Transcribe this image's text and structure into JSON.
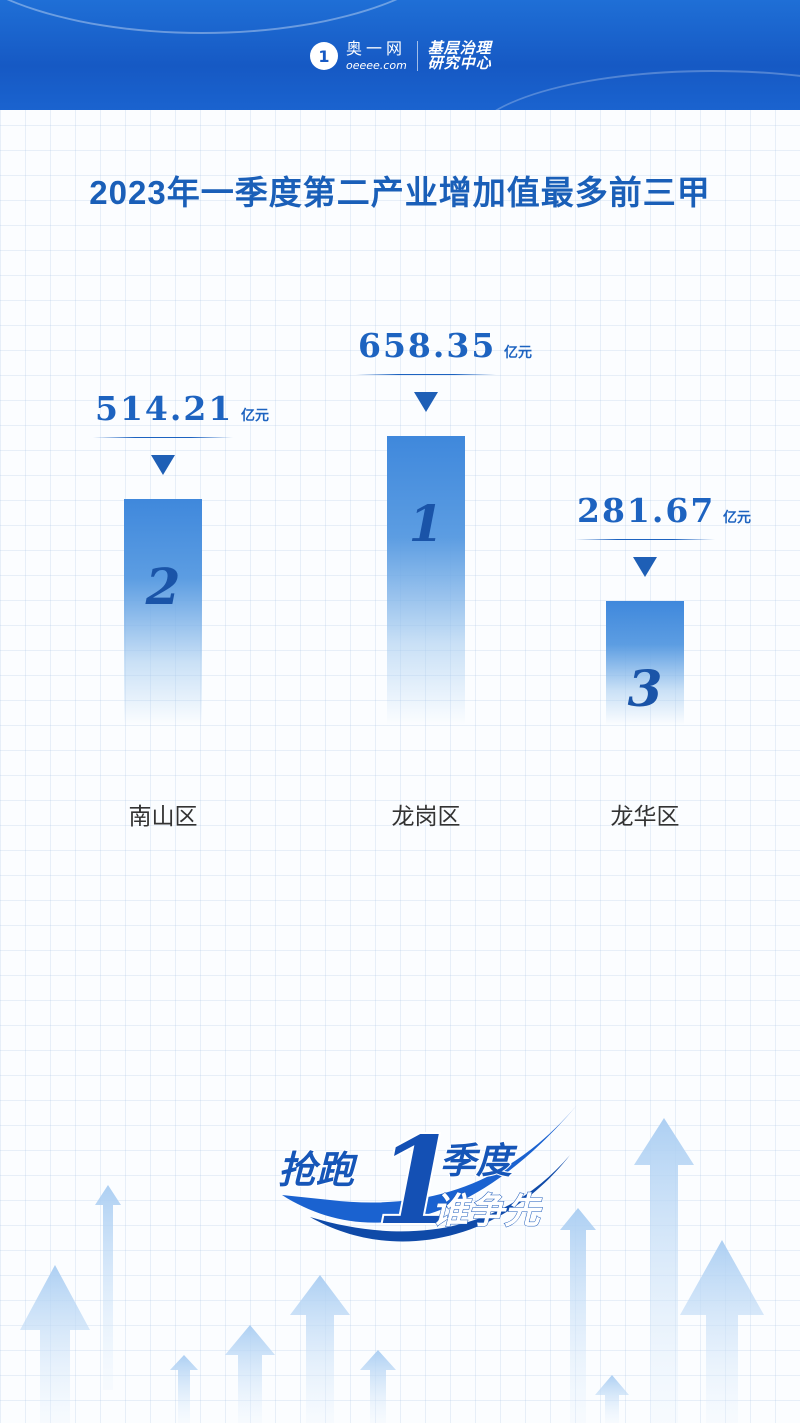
{
  "header": {
    "brand_circle": "1",
    "brand_cn": "奥一网",
    "brand_en": "oeeee.com",
    "brand_right_1": "基层治理",
    "brand_right_2": "研究中心"
  },
  "title": "2023年一季度第二产业增加值最多前三甲",
  "slogan": {
    "line1_left": "抢跑",
    "big_digit": "1",
    "line1_right": "季度",
    "line2": "谁争先"
  },
  "colors": {
    "brand_blue": "#1659c4",
    "title_blue": "#1a5fb8",
    "bar_blue": "#3f88dc",
    "rank_blue": "#1a54a8"
  },
  "chart_data": {
    "type": "bar",
    "categories": [
      "南山区",
      "龙岗区",
      "龙华区"
    ],
    "values": [
      514.21,
      658.35,
      281.67
    ],
    "value_labels": [
      "514.21",
      "658.35",
      "281.67"
    ],
    "ranks": [
      "2",
      "1",
      "3"
    ],
    "unit": "亿元",
    "title": "2023年一季度第二产业增加值最多前三甲",
    "xlabel": "",
    "ylabel": "",
    "grid": true,
    "legend": "none"
  }
}
